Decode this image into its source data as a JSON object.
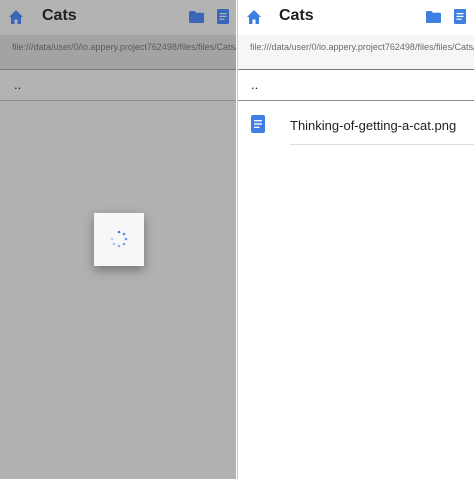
{
  "app": {
    "title": "Cats",
    "path": "file:///data/user/0/io.appery.project762498/files/files/Cats/",
    "parent_dir": ".."
  },
  "files": [
    {
      "name": "Thinking-of-getting-a-cat.png",
      "icon": "document-icon"
    }
  ],
  "colors": {
    "accent": "#3f7fe0",
    "overlay": "#b1b1b1"
  },
  "icons": [
    "home-icon",
    "folder-icon",
    "document-icon",
    "loading-spinner"
  ]
}
